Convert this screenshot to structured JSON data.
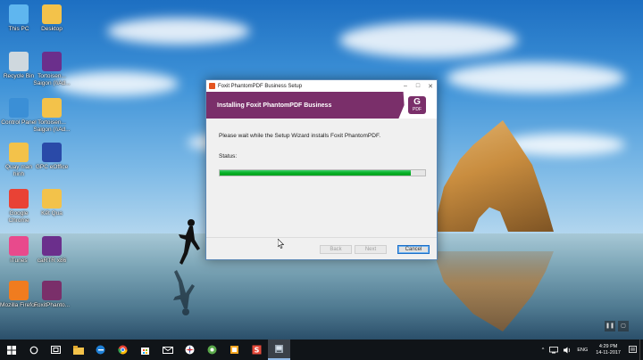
{
  "desktop": {
    "icons": [
      {
        "label": "This PC",
        "icon": "this-pc-icon",
        "color": "#5fb6ef"
      },
      {
        "label": "Desktop",
        "icon": "desktop-folder-icon",
        "color": "#f3c24a"
      },
      {
        "label": "Recycle Bin",
        "icon": "recycle-bin-icon",
        "color": "#cfd8de"
      },
      {
        "label": "Tortoisen... Saigon (\\\\Ad...",
        "icon": "winrar-icon",
        "color": "#6b2f8c"
      },
      {
        "label": "Control Panel",
        "icon": "control-panel-icon",
        "color": "#3b8fd6"
      },
      {
        "label": "Tortoisen... Saigon (\\\\Ad...",
        "icon": "folder-icon",
        "color": "#f3c24a"
      },
      {
        "label": "Quay man hinh",
        "icon": "folder-icon",
        "color": "#f3c24a"
      },
      {
        "label": "GPC eOffice",
        "icon": "eoffice-icon",
        "color": "#2a4aa8"
      },
      {
        "label": "Google Chrome",
        "icon": "chrome-icon",
        "color": "#e94235"
      },
      {
        "label": "Kết Qua",
        "icon": "folder-icon",
        "color": "#f3c24a"
      },
      {
        "label": "iTunes",
        "icon": "itunes-icon",
        "color": "#e84a8c"
      },
      {
        "label": "caRTR x86",
        "icon": "winrar-icon",
        "color": "#6b2f8c"
      },
      {
        "label": "Mozilla Firefox",
        "icon": "firefox-icon",
        "color": "#f07c1f"
      },
      {
        "label": "FoxitPhanto...",
        "icon": "foxit-setup-icon",
        "color": "#7a2f6a"
      }
    ]
  },
  "dialog": {
    "title": "Foxit PhantomPDF Business Setup",
    "heading": "Installing Foxit PhantomPDF Business",
    "logo_text": "PDF",
    "message": "Please wait while the Setup Wizard installs Foxit PhantomPDF.",
    "status_label": "Status:",
    "progress": 0.93,
    "buttons": {
      "back": "Back",
      "next": "Next",
      "cancel": "Cancel"
    },
    "accent_color": "#7a2f6a"
  },
  "taskbar": {
    "language": "ENG",
    "time": "4:29 PM",
    "date": "14-11-2017"
  }
}
